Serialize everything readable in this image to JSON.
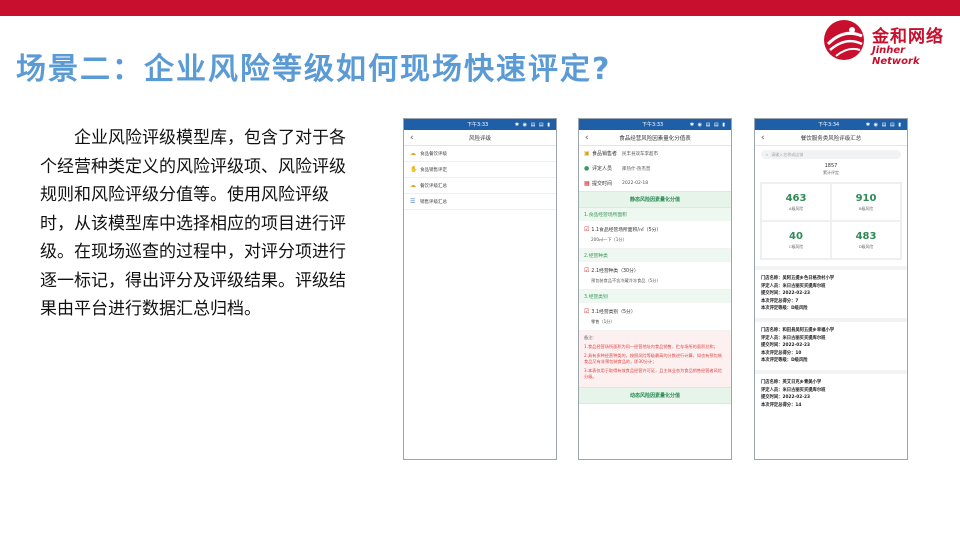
{
  "slide": {
    "title": "场景二：企业风险等级如何现场快速评定?",
    "body": "企业风险评级模型库，包含了对于各个经营种类定义的风险评级项、风险评级规则和风险评级分值等。使用风险评级时，从该模型库中选择相应的项目进行评级。在现场巡查的过程中，对评分项进行逐一标记，得出评分及评级结果。评级结果由平台进行数据汇总归档。"
  },
  "logo": {
    "cn": "金和网络",
    "en": "Jinher Network"
  },
  "colors": {
    "brand_red": "#c8102e",
    "title_blue": "#5b9bd5",
    "status_blue": "#1f5fa8",
    "accent_green": "#2e8b57"
  },
  "phones": [
    {
      "status_time": "下午3:33",
      "status_icons": "✱ ◉ ▤ ▤ ▮",
      "title": "风险评级",
      "menu": [
        "食品餐饮评级",
        "食品销售评定",
        "餐饮评级汇总",
        "销售评级汇总"
      ],
      "menu_icons": [
        "cloud-icon",
        "hand-icon",
        "cloud-icon",
        "list-icon"
      ]
    },
    {
      "status_time": "下午3:33",
      "status_icons": "✱ ◉ ▤ ▤ ▮",
      "title": "食品经营风险因素量化分值表",
      "rows": [
        {
          "label": "食品销售者",
          "value": "民丰县双车李超市"
        },
        {
          "label": "评定人员",
          "value": "库热什·热杰普"
        },
        {
          "label": "提交时间",
          "value": "2022-02-18"
        }
      ],
      "static_header": "静态风险因素量化分值",
      "sections": [
        {
          "label": "1.食品经营场所面积",
          "question": "1.1食品经营场所面积/㎡（5分）",
          "answer": "200㎡一下（1分）"
        },
        {
          "label": "2.经营种类",
          "question": "2.1经营种类（30分）",
          "answer": "预包装食品不含冷藏冷冻食品（5分）"
        },
        {
          "label": "3.经营类别",
          "question": "3.1经营类别（5分）",
          "answer": "零售（1分）"
        }
      ],
      "notes_title": "备注:",
      "notes": [
        "1.食品经营场所面积为同一经营地址内食品销售、贮存场所的面积总和；",
        "2.具有多种经营种类的，按照风险等级最高的分数进行计算，如也有预包装食品又有非预包装食品的，即30分计；",
        "3.本表仅用于取得有效食品经营许可证，且主体业态为食品销售经营者风险分级。"
      ],
      "dynamic_header": "动态风险因素量化分值"
    },
    {
      "status_time": "下午3:34",
      "status_icons": "✱ ◉ ▤ ▤ ▮",
      "title": "餐饮服务类风险评级汇总",
      "search_placeholder": "请输入名称或店铺",
      "total_value": "1857",
      "total_label": "累计评定",
      "stats": [
        {
          "value": "463",
          "label": "A级风险"
        },
        {
          "value": "910",
          "label": "B级风险"
        },
        {
          "value": "40",
          "label": "C级风险"
        },
        {
          "value": "483",
          "label": "D级风险"
        }
      ],
      "records": [
        {
          "store": "门店名称：吴阿五提乡色日格孜村小学",
          "rater": "评定人员：米日古丽买买提库尔班",
          "time": "提交时间：2022-02-23",
          "score": "本次评定总得分：7",
          "level": "本次评定等级：D级风险"
        },
        {
          "store": "门店名称：和田县吴阿五提乡幸福小学",
          "rater": "评定人员：米日古丽买买提库尔班",
          "time": "提交时间：2022-02-23",
          "score": "本次评定总得分：10",
          "level": "本次评定等级：D级风险"
        },
        {
          "store": "门店名称：英艾日克乡青美小学",
          "rater": "评定人员：米日古丽买买提库尔班",
          "time": "提交时间：2022-02-23",
          "score": "本次评定总得分：14",
          "level": ""
        }
      ]
    }
  ]
}
